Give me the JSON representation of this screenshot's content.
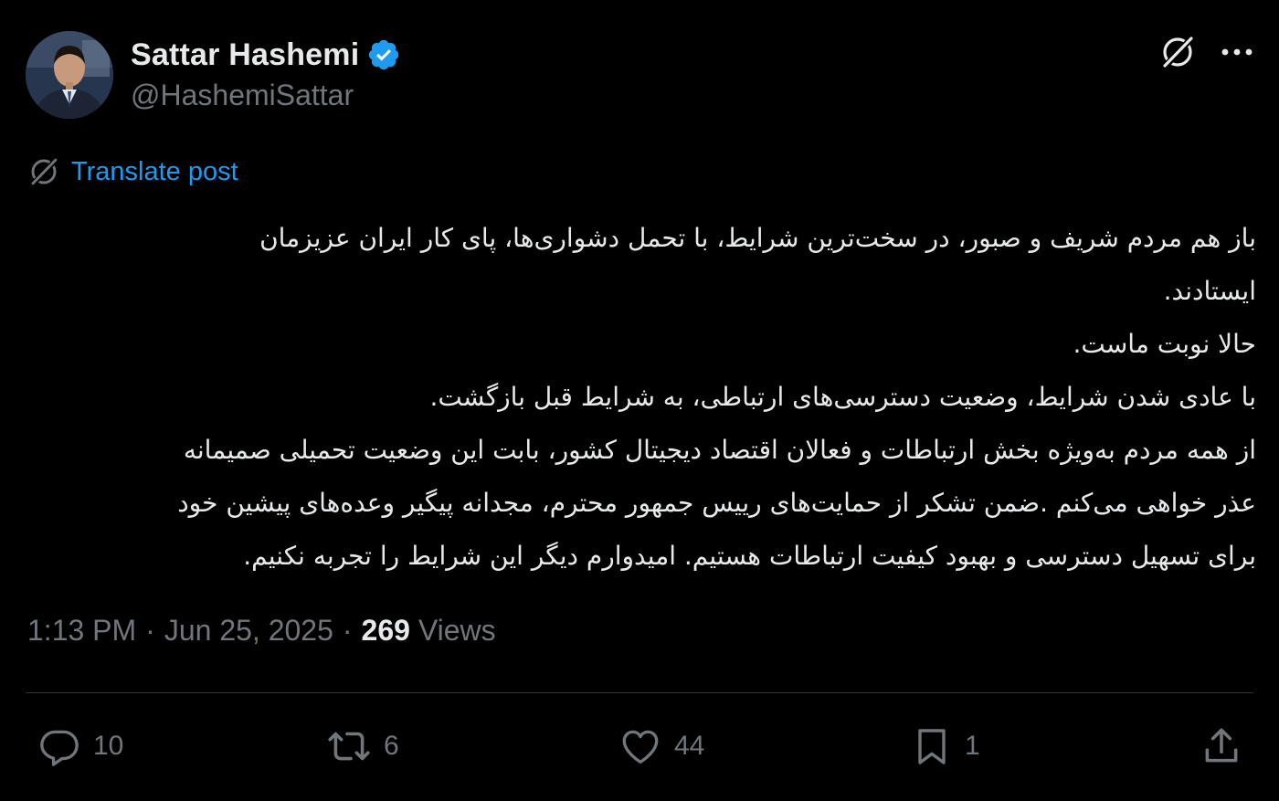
{
  "author": {
    "display_name": "Sattar Hashemi",
    "handle": "@HashemiSattar",
    "verified": true
  },
  "translate_label": "Translate post",
  "post_lines": [
    "باز هم مردم شریف و صبور، در سخت‌ترین شرایط، با تحمل دشواری‌ها، پای کار ایران عزیزمان",
    "ایستادند.",
    "حالا نوبت ماست.",
    "با عادی شدن شرایط، وضعیت دسترسی‌های ارتباطی، به شرایط قبل بازگشت.",
    "از همه مردم به‌ویژه بخش ارتباطات و فعالان اقتصاد دیجیتال کشور، بابت این وضعیت تحمیلی صمیمانه",
    "عذر خواهی می‌کنم .ضمن تشکر از حمایت‌های رییس جمهور محترم، مجدانه پیگیر وعده‌های پیشین خود",
    "برای تسهیل دسترسی و بهبود کیفیت ارتباطات هستیم. امیدوارم دیگر این شرایط را تجربه نکنیم."
  ],
  "meta": {
    "time": "1:13 PM",
    "separator": "·",
    "date": "Jun 25, 2025",
    "views_count": "269",
    "views_label": "Views"
  },
  "actions": {
    "replies": "10",
    "reposts": "6",
    "likes": "44",
    "bookmarks": "1"
  },
  "colors": {
    "background": "#000000",
    "text": "#e7e9ea",
    "secondary": "#71767b",
    "accent": "#1d9bf0",
    "divider": "#2f3336"
  },
  "icons": {
    "verified": "verified-badge-icon",
    "grok": "grok-icon",
    "more": "more-icon",
    "translate": "grok-translate-icon",
    "reply": "reply-icon",
    "repost": "repost-icon",
    "like": "like-icon",
    "bookmark": "bookmark-icon",
    "share": "share-icon"
  }
}
